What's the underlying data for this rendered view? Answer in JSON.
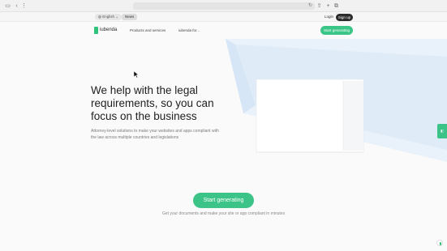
{
  "topbar": {
    "language": "English",
    "news": "News",
    "login": "Login",
    "signup": "Sign up"
  },
  "nav": {
    "brand": "iubenda",
    "items": [
      "Products and services",
      "iubenda for..."
    ],
    "cta": "Start generating"
  },
  "hero": {
    "headline": "We help with the legal requirements, so you can focus on the business",
    "subline": "Attorney-level solutions to make your websites and apps compliant with the law across multiple countries and legislations",
    "cta": "Start generating",
    "cta_note": "Get your documents and make your site or app compliant in minutes"
  },
  "colors": {
    "accent": "#3cc488",
    "dark": "#2b2b2b",
    "panel": "#e6f0f8"
  },
  "icons": [
    "sidebar-icon",
    "back-icon",
    "forward-icon",
    "reload-icon",
    "share-icon",
    "new-tab-icon",
    "tabs-icon",
    "globe-icon"
  ]
}
